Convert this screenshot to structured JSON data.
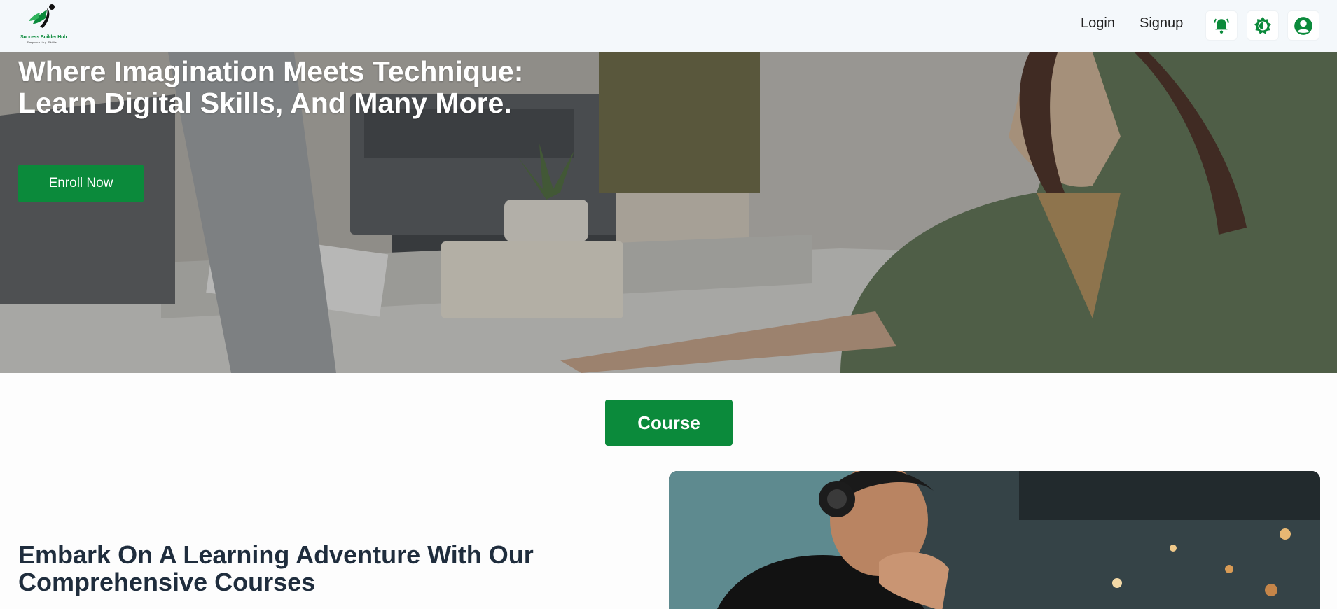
{
  "header": {
    "logo": {
      "title": "Success Builder Hub",
      "subtitle": "Empowering Skills"
    },
    "nav": {
      "login_label": "Login",
      "signup_label": "Signup"
    },
    "icons": [
      "bell-icon",
      "theme-toggle-icon",
      "user-account-icon"
    ]
  },
  "hero": {
    "title_line1": "Where Imagination Meets Technique:",
    "title_line2": "Learn Digital Skills, And Many More.",
    "cta_label": "Enroll Now"
  },
  "course_section": {
    "button_label": "Course",
    "heading_line1": "Embark On A Learning Adventure With Our",
    "heading_line2": "Comprehensive Courses"
  },
  "colors": {
    "brand_green": "#0b8a3b",
    "header_bg": "#f4f8fb",
    "heading_text": "#1f2d3d"
  }
}
